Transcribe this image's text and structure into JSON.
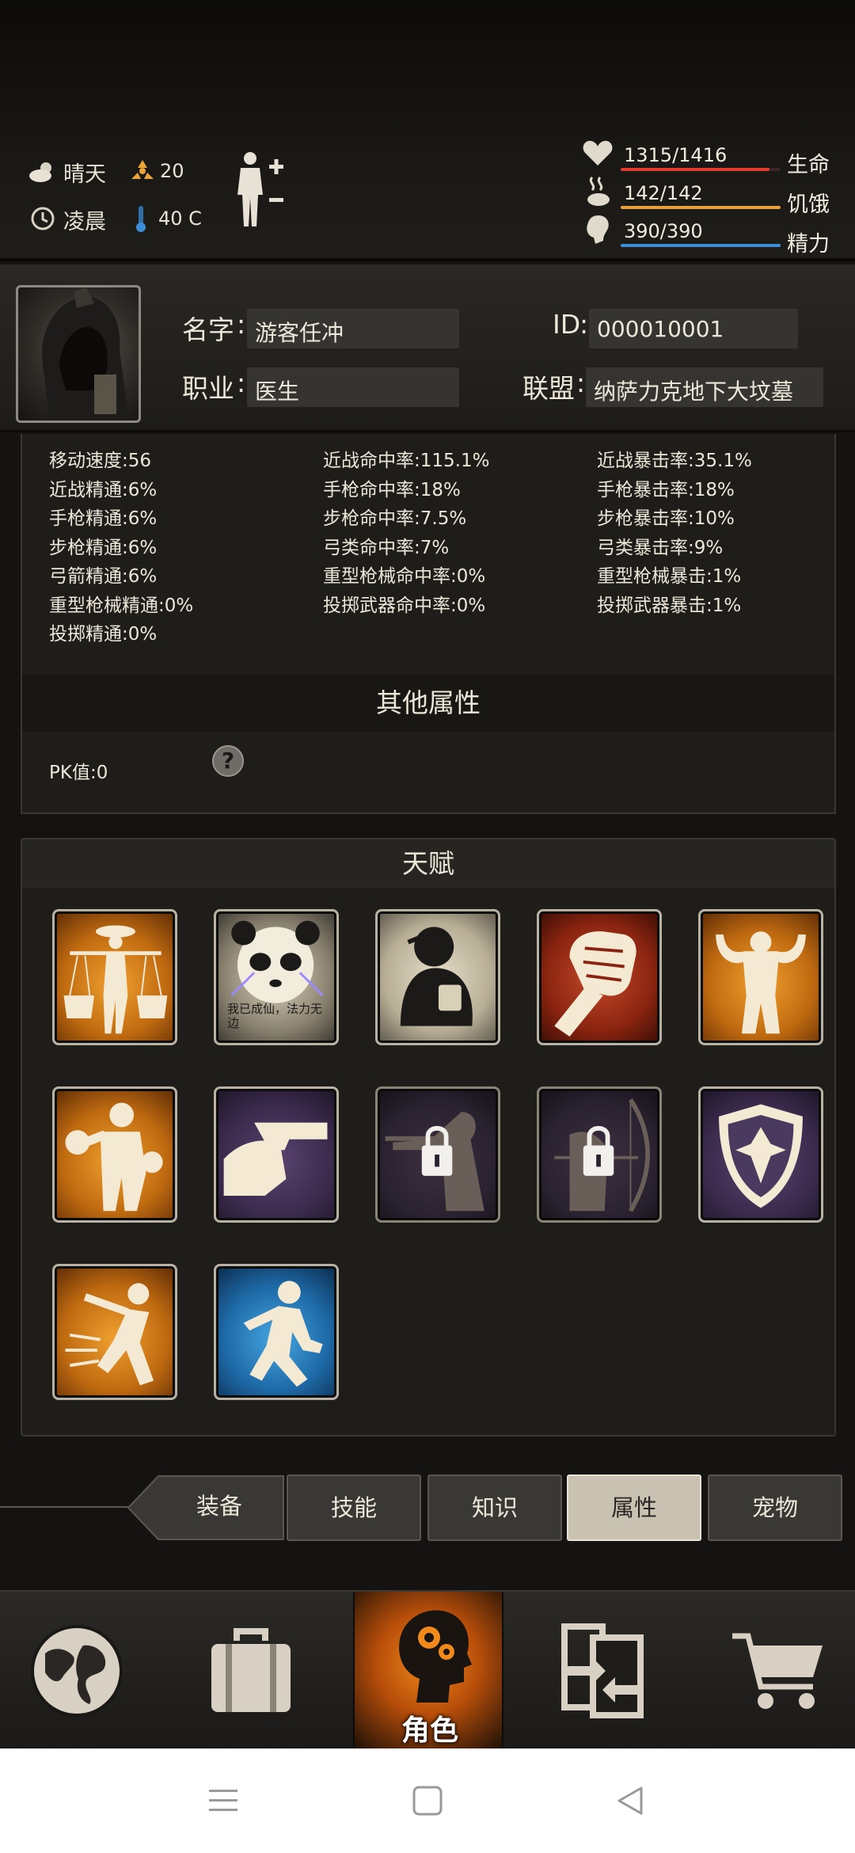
{
  "status": {
    "weather": "晴天",
    "radiation": "20",
    "time_of_day": "凌晨",
    "temperature": "40 C",
    "health": {
      "value": "1315/1416",
      "label": "生命",
      "fraction": 0.929,
      "color": "#e23a2e"
    },
    "hunger": {
      "value": "142/142",
      "label": "饥饿",
      "fraction": 1.0,
      "color": "#e8a13a"
    },
    "energy": {
      "value": "390/390",
      "label": "精力",
      "fraction": 1.0,
      "color": "#3c8fd6"
    }
  },
  "profile": {
    "name_label": "名字",
    "name_value": "游客任冲",
    "id_label": "ID",
    "id_value": "000010001",
    "job_label": "职业",
    "job_value": "医生",
    "alliance_label": "联盟",
    "alliance_value": "纳萨力克地下大坟墓"
  },
  "attributes": {
    "col1": [
      "移动速度:56",
      "近战精通:6%",
      "手枪精通:6%",
      "步枪精通:6%",
      "弓箭精通:6%",
      "重型枪械精通:0%",
      "投掷精通:0%"
    ],
    "col2": [
      "近战命中率:115.1%",
      "手枪命中率:18%",
      "步枪命中率:7.5%",
      "弓类命中率:7%",
      "重型枪械命中率:0%",
      "投掷武器命中率:0%"
    ],
    "col3": [
      "近战暴击率:35.1%",
      "手枪暴击率:18%",
      "步枪暴击率:10%",
      "弓类暴击率:9%",
      "重型枪械暴击:1%",
      "投掷武器暴击:1%"
    ]
  },
  "other": {
    "title": "其他属性",
    "pk": "PK值:0",
    "help": "?"
  },
  "talents": {
    "title": "天赋",
    "panda_caption": "我已成仙，法力无边"
  },
  "tabs": [
    "装备",
    "技能",
    "知识",
    "属性",
    "宠物"
  ],
  "nav": {
    "role_label": "角色"
  }
}
